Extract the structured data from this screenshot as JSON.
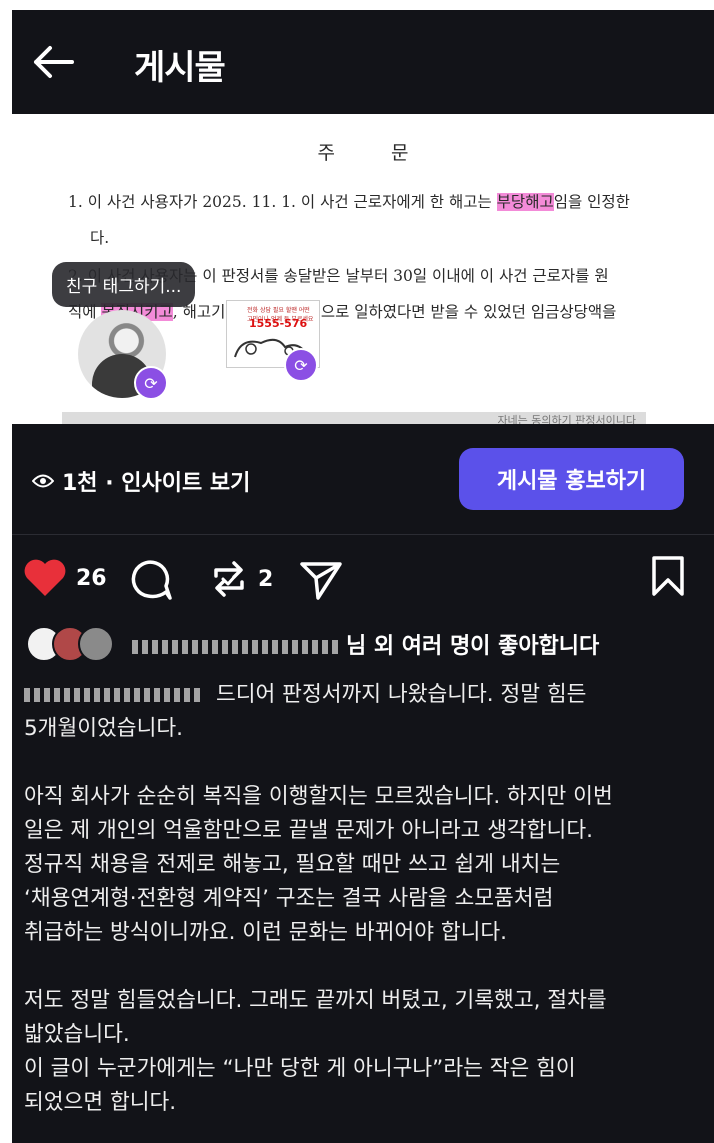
{
  "header": {
    "title": "게시물"
  },
  "document": {
    "heading": "주 문",
    "line1_pre": "1. 이 사건 사용자가 2025. 11. 1. 이 사건 근로자에게 한 해고는 ",
    "line1_highlight": "부당해고",
    "line1_post": "임을 인정한",
    "line2": "다.",
    "line3": "2. 이 사건 사용자는 이 판정서를 송달받은 날부터 30일 이내에 이 사건 근로자를 원",
    "line4_pre": "직에 ",
    "line4_highlight": "복직시키고",
    "line4_post": ", 해고기간 동안 정상적으로 일하였다면 받을 수 있었던 임금상당액을",
    "footer_fragment": "자네는 동의하기 판정서이니다"
  },
  "overlay": {
    "tag_label": "친구 태그하기...",
    "sticker_phone": "1555-576",
    "sticker_small": "전화 상담 필요 할땐 어떤 고민이나 언제 든 부르세요"
  },
  "stats": {
    "views": "1천",
    "insights_label": "· 인사이트 보기",
    "promote_label": "게시물 홍보하기"
  },
  "actions": {
    "like_count": "26",
    "repost_count": "2"
  },
  "likes": {
    "text": "님 외 여러 명이 좋아합니다"
  },
  "caption": {
    "p1": "드디어 판정서까지 나왔습니다. 정말 힘든\n5개월이었습니다.",
    "p2": "아직 회사가 순순히 복직을 이행할지는 모르겠습니다. 하지만 이번\n일은 제 개인의 억울함만으로 끝낼 문제가 아니라고 생각합니다.\n정규직 채용을 전제로 해놓고, 필요할 때만 쓰고 쉽게 내치는\n‘채용연계형·전환형 계약직’ 구조는 결국 사람을 소모품처럼\n취급하는 방식이니까요. 이런 문화는 바뀌어야 합니다.",
    "p3": "저도 정말 힘들었습니다. 그래도 끝까지 버텼고, 기록했고, 절차를\n밟았습니다.\n이 글이 누군가에게는 “나만 당한 게 아니구나”라는 작은 힘이\n되었으면 합니다."
  },
  "colors": {
    "background": "#121318",
    "accent": "#5b51ea",
    "like": "#e8303a",
    "repost_badge": "#8b4fe4",
    "highlight": "#f38bd8"
  }
}
